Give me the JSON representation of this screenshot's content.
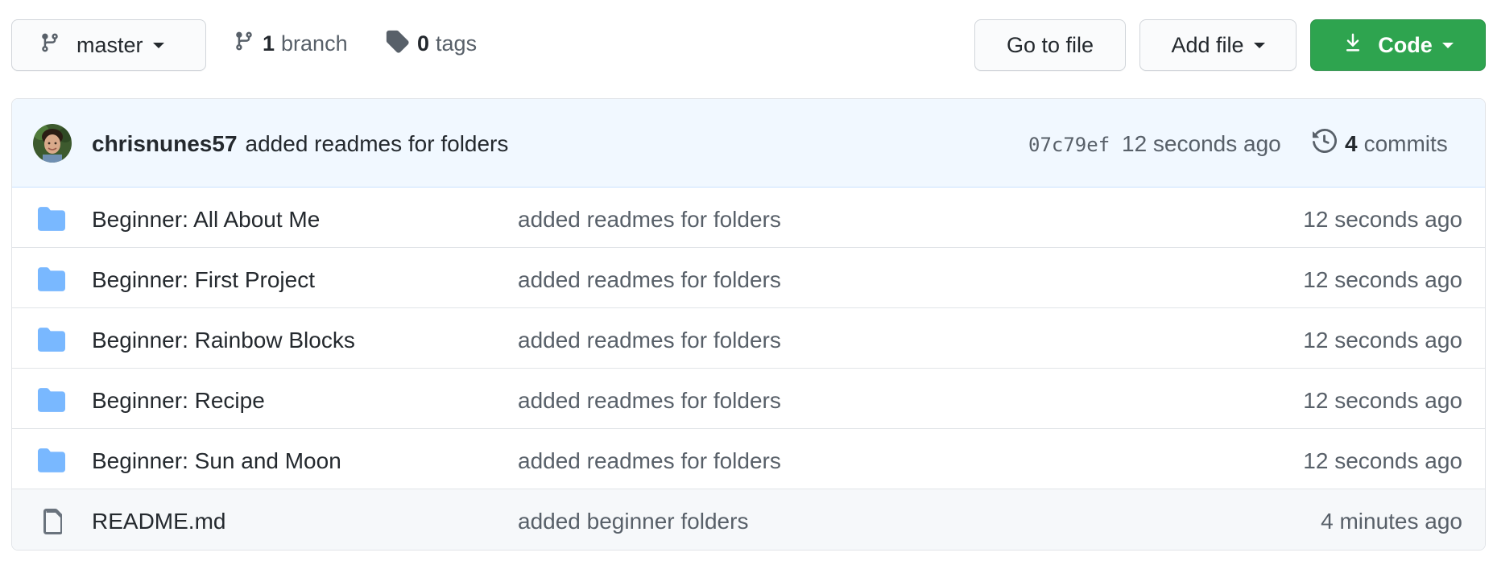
{
  "toolbar": {
    "branch_name": "master",
    "branch_count": "1",
    "branch_label": "branch",
    "tag_count": "0",
    "tag_label": "tags",
    "go_to_file_label": "Go to file",
    "add_file_label": "Add file",
    "code_label": "Code"
  },
  "commit": {
    "author": "chrisnunes57",
    "message": "added readmes for folders",
    "sha": "07c79ef",
    "age": "12 seconds ago",
    "commit_count": "4",
    "commits_label": "commits"
  },
  "files": [
    {
      "icon": "folder-icon",
      "name": "Beginner: All About Me",
      "message": "added readmes for folders",
      "age": "12 seconds ago"
    },
    {
      "icon": "folder-icon",
      "name": "Beginner: First Project",
      "message": "added readmes for folders",
      "age": "12 seconds ago"
    },
    {
      "icon": "folder-icon",
      "name": "Beginner: Rainbow Blocks",
      "message": "added readmes for folders",
      "age": "12 seconds ago"
    },
    {
      "icon": "folder-icon",
      "name": "Beginner: Recipe",
      "message": "added readmes for folders",
      "age": "12 seconds ago"
    },
    {
      "icon": "folder-icon",
      "name": "Beginner: Sun and Moon",
      "message": "added readmes for folders",
      "age": "12 seconds ago"
    },
    {
      "icon": "file-icon",
      "name": "README.md",
      "message": "added beginner folders",
      "age": "4 minutes ago"
    }
  ],
  "colors": {
    "code_button": "#2ea44f",
    "folder_icon": "#79b8ff",
    "commit_header_bg": "#f1f8ff"
  }
}
